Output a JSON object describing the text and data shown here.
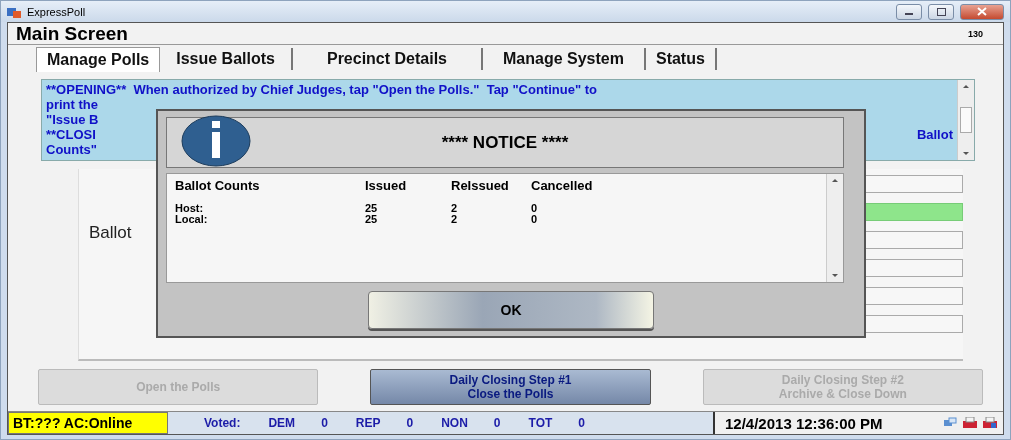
{
  "window": {
    "title": "ExpressPoll"
  },
  "header": {
    "title": "Main Screen",
    "number": "130"
  },
  "tabs": [
    {
      "label": "Manage Polls",
      "selected": true
    },
    {
      "label": "Issue Ballots",
      "selected": false
    },
    {
      "label": "Precinct Details",
      "selected": false
    },
    {
      "label": "Manage System",
      "selected": false
    },
    {
      "label": "Status",
      "selected": false
    }
  ],
  "instructions": {
    "lines": [
      {
        "left": "**OPENING**  When authorized by Chief Judges, tap \"Open the Polls.\"  Tap \"Continue\" to"
      },
      {
        "left": "print the"
      },
      {
        "left": "\"Issue B"
      },
      {
        "left": "**CLOSI",
        "right": "Ballot"
      },
      {
        "left": "Counts\""
      }
    ]
  },
  "ballot_panel": {
    "label": "Ballot",
    "fields": [
      {
        "highlighted": false
      },
      {
        "highlighted": true
      },
      {
        "highlighted": false
      },
      {
        "highlighted": false
      },
      {
        "highlighted": false
      },
      {
        "highlighted": false
      }
    ]
  },
  "dialog": {
    "title": "**** NOTICE ****",
    "columns": [
      "Ballot Counts",
      "Issued",
      "ReIssued",
      "Cancelled"
    ],
    "rows": [
      {
        "cells": [
          "Host:",
          "25",
          "2",
          "0"
        ]
      },
      {
        "cells": [
          "Local:",
          "25",
          "2",
          "0"
        ]
      }
    ],
    "button": "OK"
  },
  "buttons": [
    {
      "lines": [
        "Open the Polls"
      ],
      "disabled": true
    },
    {
      "lines": [
        "Daily Closing Step #1",
        "Close the Polls"
      ],
      "disabled": false
    },
    {
      "lines": [
        "Daily Closing Step #2",
        "Archive & Close Down"
      ],
      "disabled": true
    }
  ],
  "status_bar": {
    "connection": "BT:??? AC:Online",
    "voted_label": "Voted:",
    "counts": [
      {
        "party": "DEM",
        "count": "0"
      },
      {
        "party": "REP",
        "count": "0"
      },
      {
        "party": "NON",
        "count": "0"
      },
      {
        "party": "TOT",
        "count": "0"
      }
    ],
    "datetime": "12/4/2013 12:36:00 PM"
  }
}
